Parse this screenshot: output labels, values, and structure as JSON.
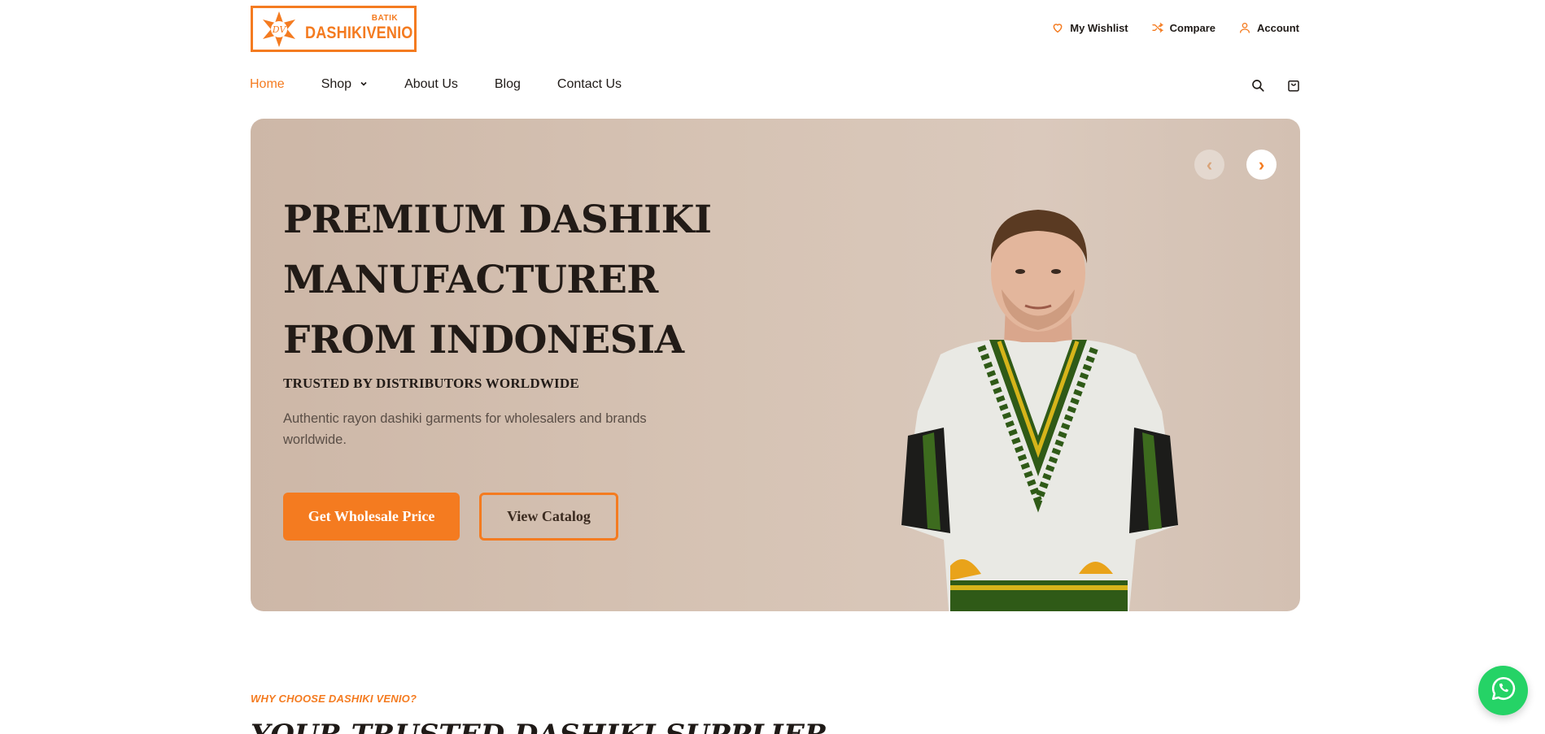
{
  "header": {
    "logo": {
      "small_text": "BATIK",
      "brand_text": "DASHIKIVENIO",
      "mark_text": "DV"
    },
    "top_links": [
      {
        "label": "My Wishlist",
        "icon": "heart-icon"
      },
      {
        "label": "Compare",
        "icon": "shuffle-icon"
      },
      {
        "label": "Account",
        "icon": "user-icon"
      }
    ]
  },
  "nav": {
    "items": [
      {
        "label": "Home",
        "active": true
      },
      {
        "label": "Shop",
        "dropdown": true
      },
      {
        "label": "About Us"
      },
      {
        "label": "Blog"
      },
      {
        "label": "Contact Us"
      }
    ],
    "icons": [
      "search-icon",
      "cart-icon"
    ]
  },
  "hero": {
    "title": "PREMIUM DASHIKI MANUFACTURER FROM INDONESIA",
    "subtitle": "TRUSTED BY DISTRIBUTORS WORLDWIDE",
    "description": "Authentic rayon dashiki garments for wholesalers and brands worldwide.",
    "primary_button": "Get Wholesale Price",
    "secondary_button": "View Catalog",
    "prev_arrow": "‹",
    "next_arrow": "›"
  },
  "section": {
    "eyebrow": "WHY CHOOSE DASHIKI VENIO?",
    "title": "YOUR TRUSTED DASHIKI SUPPLIER"
  },
  "colors": {
    "accent": "#f47b20",
    "text": "#1f1a17",
    "hero_bg": "#d6c3b4",
    "whatsapp": "#25d366"
  }
}
